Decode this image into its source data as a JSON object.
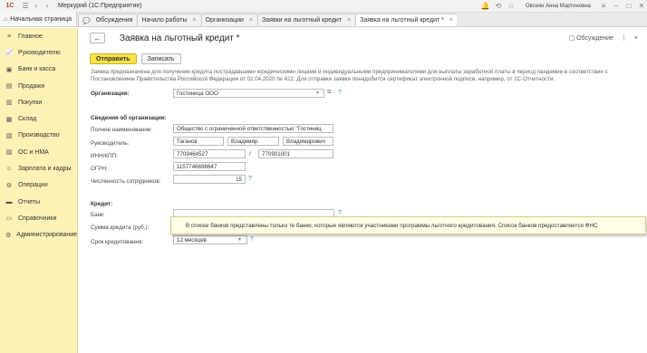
{
  "titlebar": {
    "logo": "1С",
    "title": "Меркурий  (1С:Предприятие)",
    "user": "Овсеян Анна Мартиновна"
  },
  "tabs": {
    "home": "Начальная страница",
    "items": [
      {
        "label": "Обсуждения"
      },
      {
        "label": "Начало работы"
      },
      {
        "label": "Организации"
      },
      {
        "label": "Заявки на льготный кредит"
      },
      {
        "label": "Заявка на льготный кредит *"
      }
    ]
  },
  "sidebar": {
    "items": [
      {
        "label": "Главное",
        "icon": "menu-icon"
      },
      {
        "label": "Руководителю",
        "icon": "chart-icon"
      },
      {
        "label": "Банк и касса",
        "icon": "bank-icon"
      },
      {
        "label": "Продажи",
        "icon": "cart-icon"
      },
      {
        "label": "Покупки",
        "icon": "basket-icon"
      },
      {
        "label": "Склад",
        "icon": "warehouse-icon"
      },
      {
        "label": "Производство",
        "icon": "factory-icon"
      },
      {
        "label": "ОС и НМА",
        "icon": "assets-icon"
      },
      {
        "label": "Зарплата и кадры",
        "icon": "people-icon"
      },
      {
        "label": "Операции",
        "icon": "operations-icon"
      },
      {
        "label": "Отчеты",
        "icon": "reports-icon"
      },
      {
        "label": "Справочники",
        "icon": "book-icon"
      },
      {
        "label": "Администрирование",
        "icon": "gear-icon"
      }
    ]
  },
  "form": {
    "title": "Заявка на льготный кредит *",
    "discussion": "Обсуждение",
    "send_btn": "Отправить",
    "save_btn": "Записать",
    "description": "Заявка предназначена для получения кредита пострадавшими юридическими лицами и индивидуальными предпринимателями для выплаты заработной платы в период пандемии в соответствии с Постановлением Правительства Российской Федерации от 02.04.2020 № 422. Для отправки заявки понадобится сертификат электронной подписи, например, от 1С-Отчетности.",
    "org_label": "Организация:",
    "org_value": "Гостиница ООО",
    "info_heading": "Сведения об организации:",
    "full_name_label": "Полное наименование:",
    "full_name_value": "Общество с ограниченной ответственностью \"Гостиниц",
    "head_label": "Руководитель:",
    "head_last": "Таганов",
    "head_first": "Владимир",
    "head_middle": "Владимирович",
    "inn_label": "ИНН/КПП:",
    "inn_value": "7709464527",
    "slash": "/",
    "kpp_value": "770901001",
    "ogrn_label": "ОГРН:",
    "ogrn_value": "1157746698647",
    "staff_label": "Численность сотрудников:",
    "staff_value": "15",
    "credit_heading": "Кредит:",
    "bank_label": "Банк:",
    "bank_value": "",
    "amount_label": "Сумма кредита (руб.):",
    "amount_value": "",
    "term_label": "Срок кредитования:",
    "term_value": "12 месяцев",
    "help": "?"
  },
  "tooltip": {
    "text": "В списке банков представлены только те банки, которые являются участниками программы льготного кредитования. Список банков предоставляется ФНС"
  }
}
